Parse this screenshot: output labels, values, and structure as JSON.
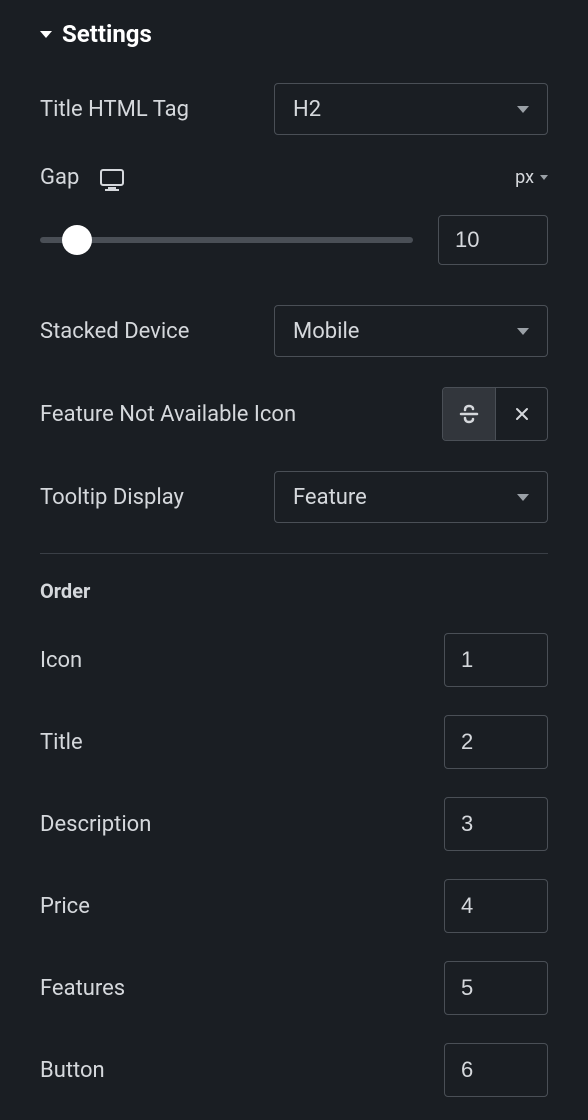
{
  "section": {
    "title": "Settings"
  },
  "settings": {
    "titleHtmlTag": {
      "label": "Title HTML Tag",
      "value": "H2"
    },
    "gap": {
      "label": "Gap",
      "unit": "px",
      "value": "10"
    },
    "stackedDevice": {
      "label": "Stacked Device",
      "value": "Mobile"
    },
    "featureNotAvailable": {
      "label": "Feature Not Available Icon",
      "icon": "strikethrough-icon"
    },
    "tooltipDisplay": {
      "label": "Tooltip Display",
      "value": "Feature"
    }
  },
  "order": {
    "title": "Order",
    "items": [
      {
        "label": "Icon",
        "value": "1"
      },
      {
        "label": "Title",
        "value": "2"
      },
      {
        "label": "Description",
        "value": "3"
      },
      {
        "label": "Price",
        "value": "4"
      },
      {
        "label": "Features",
        "value": "5"
      },
      {
        "label": "Button",
        "value": "6"
      }
    ]
  }
}
